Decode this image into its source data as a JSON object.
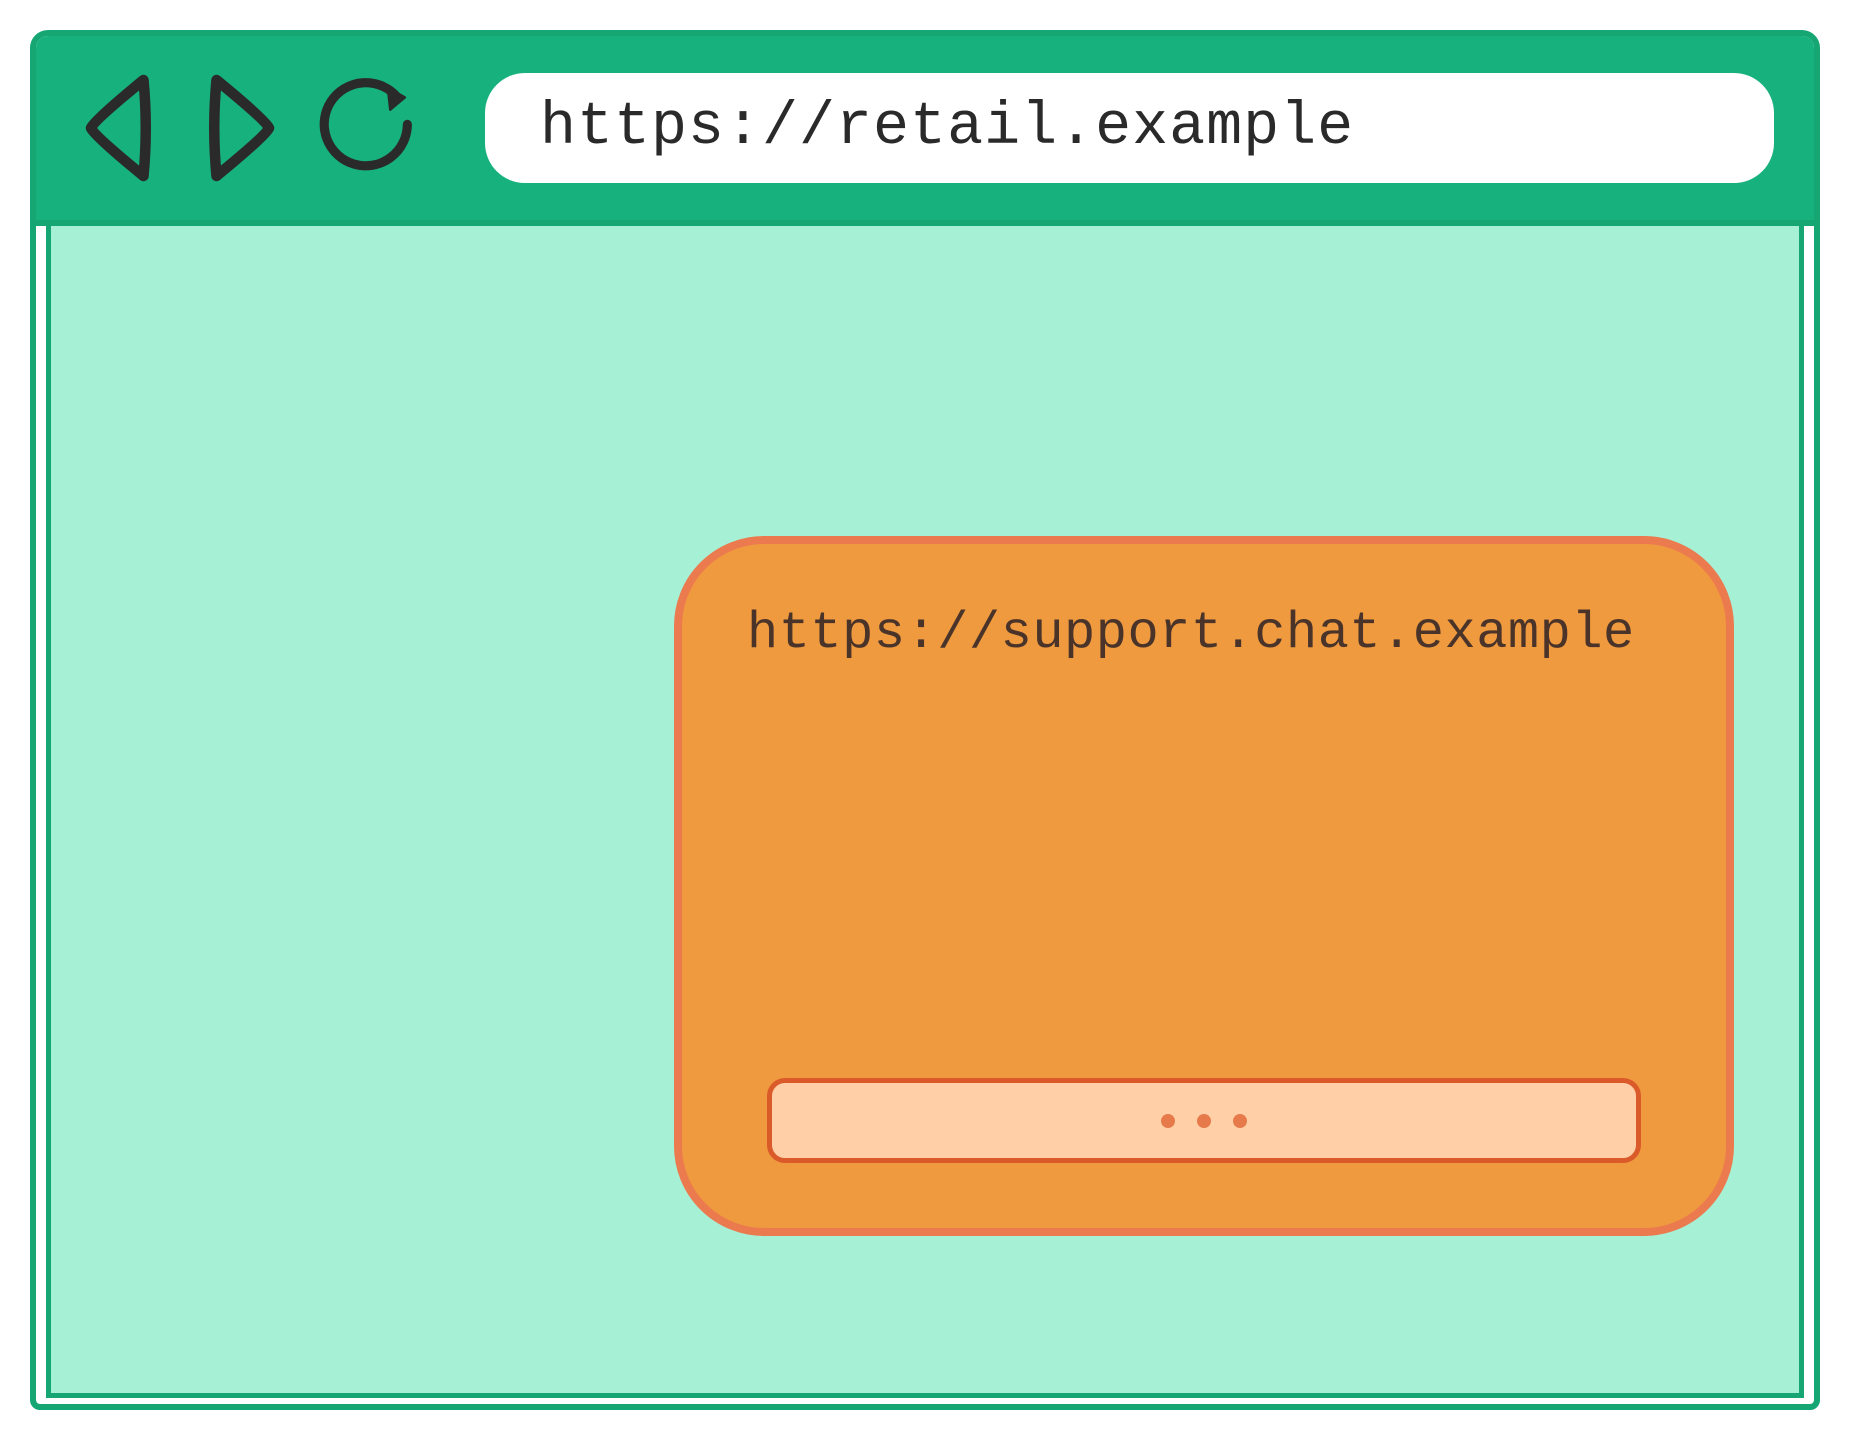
{
  "browser": {
    "toolbar": {
      "back_icon": "back-icon",
      "forward_icon": "forward-icon",
      "reload_icon": "reload-icon",
      "address_url": "https://retail.example"
    },
    "viewport": {
      "chat_widget": {
        "origin_url": "https://support.chat.example",
        "input_placeholder": "..."
      }
    }
  }
}
